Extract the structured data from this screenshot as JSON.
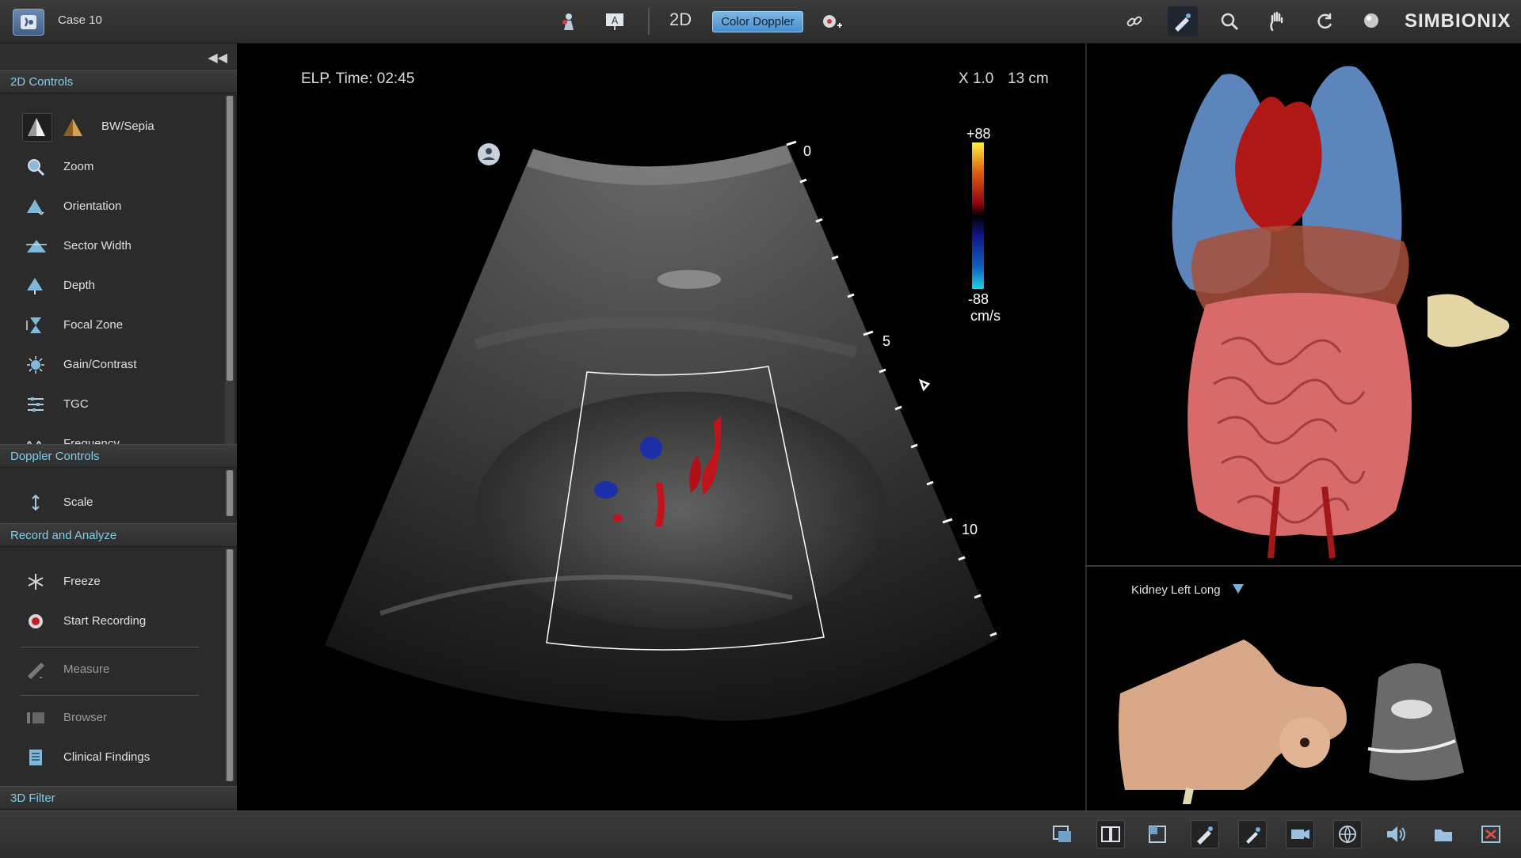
{
  "header": {
    "case_title": "Case 10",
    "mode_label": "2D",
    "color_doppler_label": "Color Doppler",
    "brand": "SIMBIONIX"
  },
  "sidebar": {
    "sections": {
      "controls_2d": "2D Controls",
      "doppler_controls": "Doppler Controls",
      "record_analyze": "Record and Analyze",
      "filter_3d": "3D Filter"
    },
    "controls_2d_items": {
      "bw_sepia": "BW/Sepia",
      "zoom": "Zoom",
      "orientation": "Orientation",
      "sector_width": "Sector Width",
      "depth": "Depth",
      "focal_zone": "Focal Zone",
      "gain_contrast": "Gain/Contrast",
      "tgc": "TGC",
      "frequency": "Frequency"
    },
    "doppler_items": {
      "scale": "Scale"
    },
    "record_items": {
      "freeze": "Freeze",
      "start_recording": "Start Recording",
      "measure": "Measure",
      "browser": "Browser",
      "clinical_findings": "Clinical Findings"
    }
  },
  "ultrasound": {
    "elapsed_time": "ELP. Time: 02:45",
    "zoom": "X 1.0",
    "depth": "13 cm",
    "velocity_scale": {
      "max": "+88",
      "min": "-88",
      "unit": "cm/s"
    },
    "depth_marks": {
      "zero": "0",
      "five": "5",
      "ten": "10"
    }
  },
  "plane_panel": {
    "selected_plane": "Kidney Left Long"
  },
  "colors": {
    "accent_section": "#7fd0e8",
    "doppler_button": "#5a9fd6",
    "doppler_red": "#c0141c",
    "doppler_blue": "#1a2fa8"
  }
}
